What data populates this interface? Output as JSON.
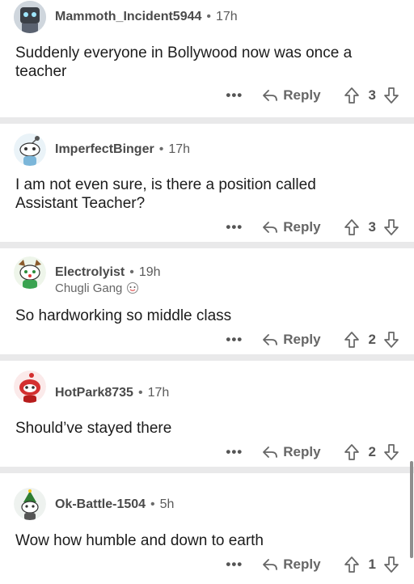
{
  "comments": [
    {
      "username": "Mammoth_Incident5944",
      "time": "17h",
      "flair": "",
      "body": "Suddenly everyone in Bollywood now was once a teacher",
      "reply_label": "Reply",
      "votes": "3",
      "avatar_icon": "robot-avatar-icon"
    },
    {
      "username": "ImperfectBinger",
      "time": "17h",
      "flair": "",
      "body": "I am not even sure, is there a position called Assistant Teacher?",
      "reply_label": "Reply",
      "votes": "3",
      "avatar_icon": "snoo-avatar-icon"
    },
    {
      "username": "Electrolyist",
      "time": "19h",
      "flair": "Chugli Gang",
      "body": "So hardworking so middle class",
      "reply_label": "Reply",
      "votes": "2",
      "avatar_icon": "holiday-snoo-avatar-icon"
    },
    {
      "username": "HotPark8735",
      "time": "17h",
      "flair": "",
      "body": "Should’ve stayed there",
      "reply_label": "Reply",
      "votes": "2",
      "avatar_icon": "red-snoo-avatar-icon"
    },
    {
      "username": "Ok-Battle-1504",
      "time": "5h",
      "flair": "",
      "body": "Wow how humble and down to earth",
      "reply_label": "Reply",
      "votes": "1",
      "avatar_icon": "tree-snoo-avatar-icon"
    }
  ],
  "more_label": "•••",
  "separator": "•",
  "colors": {
    "background": "#e9e9ea",
    "card": "#ffffff",
    "meta": "#4a4a4a",
    "action": "#666666"
  }
}
